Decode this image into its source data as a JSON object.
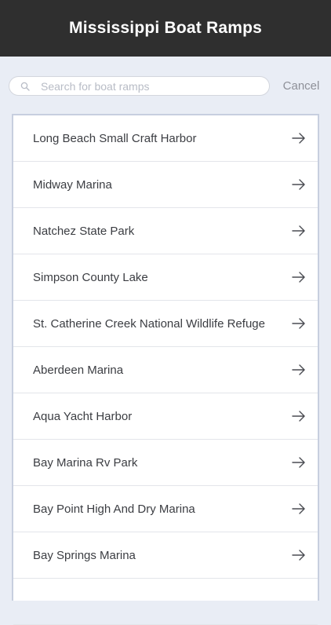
{
  "header": {
    "title": "Mississippi Boat Ramps"
  },
  "search": {
    "placeholder": "Search for boat ramps",
    "value": "",
    "icon": "search-icon",
    "cancel_label": "Cancel"
  },
  "list": {
    "items": [
      {
        "label": "Long Beach Small Craft Harbor",
        "icon": "arrow-right-icon"
      },
      {
        "label": "Midway Marina",
        "icon": "arrow-right-icon"
      },
      {
        "label": "Natchez State Park",
        "icon": "arrow-right-icon"
      },
      {
        "label": "Simpson County Lake",
        "icon": "arrow-right-icon"
      },
      {
        "label": "St. Catherine Creek National Wildlife Refuge",
        "icon": "arrow-right-icon"
      },
      {
        "label": "Aberdeen Marina",
        "icon": "arrow-right-icon"
      },
      {
        "label": "Aqua Yacht Harbor",
        "icon": "arrow-right-icon"
      },
      {
        "label": "Bay Marina Rv Park",
        "icon": "arrow-right-icon"
      },
      {
        "label": "Bay Point High And Dry Marina",
        "icon": "arrow-right-icon"
      },
      {
        "label": "Bay Springs Marina",
        "icon": "arrow-right-icon"
      }
    ]
  },
  "colors": {
    "header_bg": "#2f2f2f",
    "page_bg": "#e9edf5",
    "list_border": "#c7cfdf",
    "text": "#3b3d42",
    "cancel": "#8e9098"
  }
}
